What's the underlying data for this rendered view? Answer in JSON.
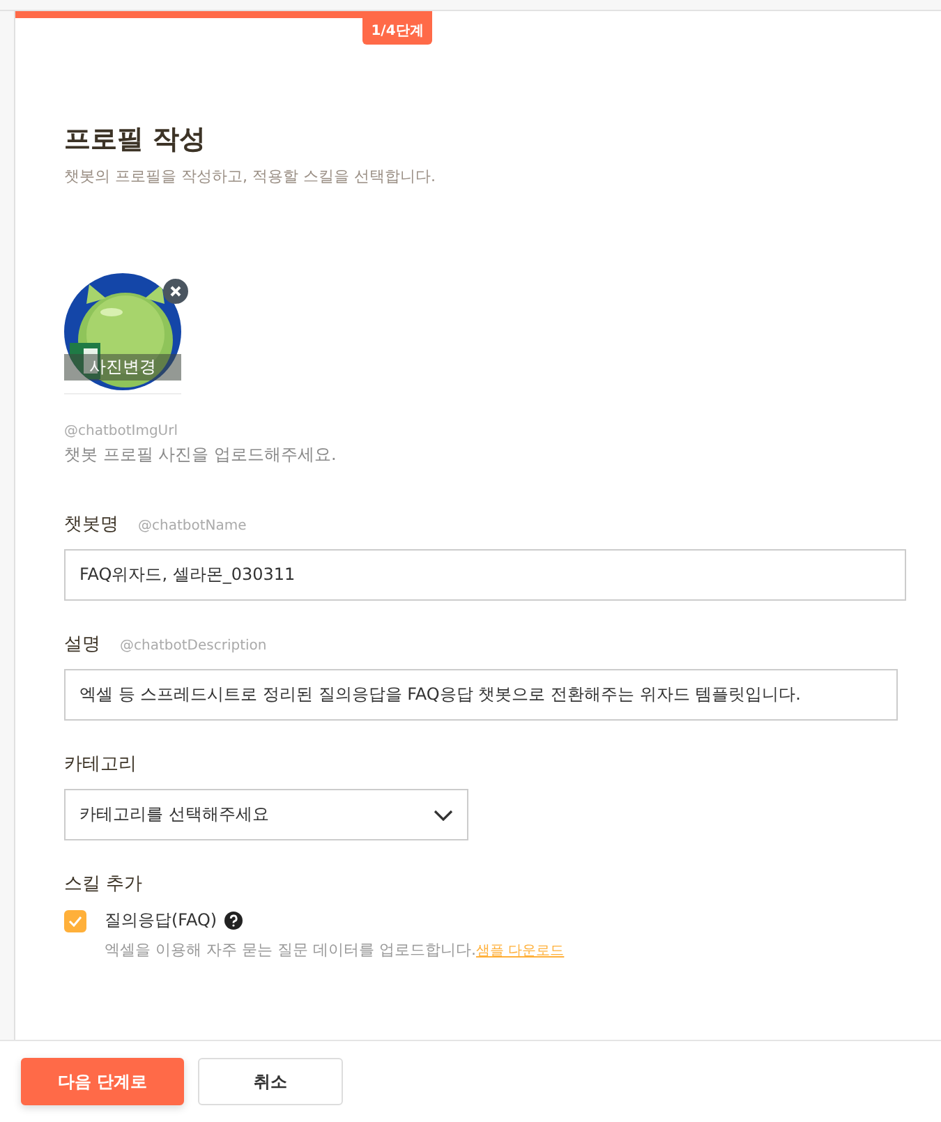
{
  "progress": {
    "label": "1/4단계"
  },
  "header": {
    "title": "프로필 작성",
    "subtitle": "챗봇의 프로필을 작성하고, 적용할 스킬을 선택합니다."
  },
  "profile_image": {
    "change_label": "사진변경",
    "variable": "@chatbotImgUrl",
    "hint": "챗봇 프로필 사진을 업로드해주세요."
  },
  "fields": [
    {
      "kind": "input",
      "label": "챗봇명",
      "variable": "@chatbotName",
      "value": "FAQ위자드, 셀라몬_030311"
    },
    {
      "kind": "input",
      "label": "설명",
      "variable": "@chatbotDescription",
      "value": "엑셀 등 스프레드시트로 정리된 질의응답을 FAQ응답 챗봇으로 전환해주는 위자드 템플릿입니다."
    },
    {
      "kind": "select",
      "label": "카테고리",
      "placeholder": "카테고리를 선택해주세요"
    }
  ],
  "skills": {
    "label": "스킬 추가",
    "items": [
      {
        "name": "질의응답(FAQ)",
        "checked": true,
        "description": "엑셀을 이용해 자주 묻는 질문 데이터를 업로드합니다.",
        "link": "샘플 다운로드"
      }
    ]
  },
  "buttons": [
    {
      "kind": "primary",
      "label": "다음 단계로"
    },
    {
      "kind": "secondary",
      "label": "취소"
    }
  ]
}
